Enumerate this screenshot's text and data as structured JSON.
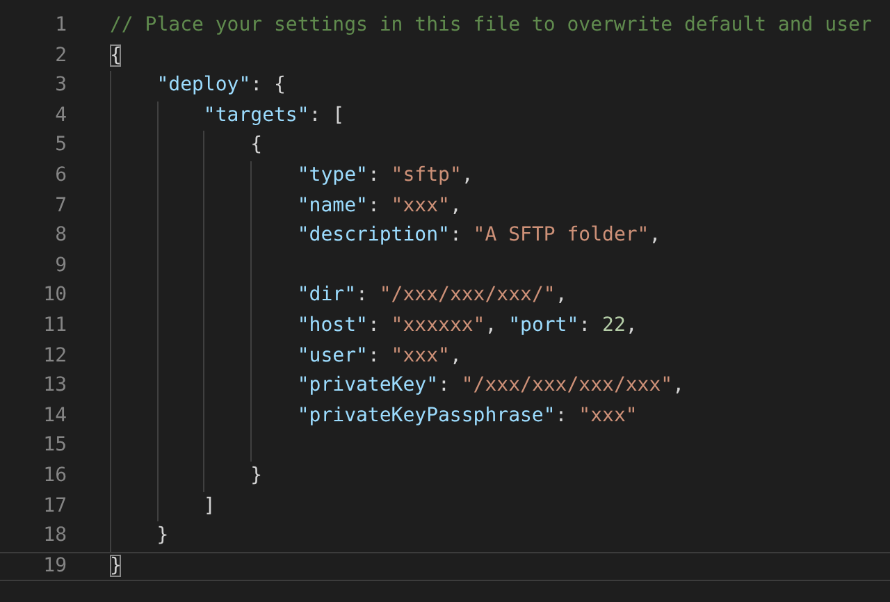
{
  "editor": {
    "lines": [
      {
        "number": "1",
        "current": false,
        "tokens": [
          {
            "kind": "comment",
            "text": "// Place your settings in this file to overwrite default and user"
          }
        ]
      },
      {
        "number": "2",
        "current": false,
        "tokens": [
          {
            "kind": "punct",
            "text": "{",
            "matched": true
          }
        ]
      },
      {
        "number": "3",
        "current": false,
        "tokens": [
          {
            "kind": "key",
            "text": "    \"deploy\""
          },
          {
            "kind": "punct",
            "text": ": {"
          }
        ]
      },
      {
        "number": "4",
        "current": false,
        "tokens": [
          {
            "kind": "key",
            "text": "        \"targets\""
          },
          {
            "kind": "punct",
            "text": ": ["
          }
        ]
      },
      {
        "number": "5",
        "current": false,
        "tokens": [
          {
            "kind": "punct",
            "text": "            {"
          }
        ]
      },
      {
        "number": "6",
        "current": false,
        "tokens": [
          {
            "kind": "key",
            "text": "                \"type\""
          },
          {
            "kind": "punct",
            "text": ": "
          },
          {
            "kind": "string",
            "text": "\"sftp\""
          },
          {
            "kind": "punct",
            "text": ","
          }
        ]
      },
      {
        "number": "7",
        "current": false,
        "tokens": [
          {
            "kind": "key",
            "text": "                \"name\""
          },
          {
            "kind": "punct",
            "text": ": "
          },
          {
            "kind": "string",
            "text": "\"xxx\""
          },
          {
            "kind": "punct",
            "text": ","
          }
        ]
      },
      {
        "number": "8",
        "current": false,
        "tokens": [
          {
            "kind": "key",
            "text": "                \"description\""
          },
          {
            "kind": "punct",
            "text": ": "
          },
          {
            "kind": "string",
            "text": "\"A SFTP folder\""
          },
          {
            "kind": "punct",
            "text": ","
          }
        ]
      },
      {
        "number": "9",
        "current": false
      },
      {
        "number": "10",
        "current": false,
        "tokens": [
          {
            "kind": "key",
            "text": "                \"dir\""
          },
          {
            "kind": "punct",
            "text": ": "
          },
          {
            "kind": "string",
            "text": "\"/xxx/xxx/xxx/\""
          },
          {
            "kind": "punct",
            "text": ","
          }
        ]
      },
      {
        "number": "11",
        "current": false,
        "tokens": [
          {
            "kind": "key",
            "text": "                \"host\""
          },
          {
            "kind": "punct",
            "text": ": "
          },
          {
            "kind": "string",
            "text": "\"xxxxxx\""
          },
          {
            "kind": "punct",
            "text": ", "
          },
          {
            "kind": "key",
            "text": "\"port\""
          },
          {
            "kind": "punct",
            "text": ": "
          },
          {
            "kind": "number",
            "text": "22"
          },
          {
            "kind": "punct",
            "text": ","
          }
        ]
      },
      {
        "number": "12",
        "current": false,
        "tokens": [
          {
            "kind": "key",
            "text": "                \"user\""
          },
          {
            "kind": "punct",
            "text": ": "
          },
          {
            "kind": "string",
            "text": "\"xxx\""
          },
          {
            "kind": "punct",
            "text": ","
          }
        ]
      },
      {
        "number": "13",
        "current": false,
        "tokens": [
          {
            "kind": "key",
            "text": "                \"privateKey\""
          },
          {
            "kind": "punct",
            "text": ": "
          },
          {
            "kind": "string",
            "text": "\"/xxx/xxx/xxx/xxx\""
          },
          {
            "kind": "punct",
            "text": ","
          }
        ]
      },
      {
        "number": "14",
        "current": false,
        "tokens": [
          {
            "kind": "key",
            "text": "                \"privateKeyPassphrase\""
          },
          {
            "kind": "punct",
            "text": ": "
          },
          {
            "kind": "string",
            "text": "\"xxx\""
          }
        ]
      },
      {
        "number": "15",
        "current": false
      },
      {
        "number": "16",
        "current": false,
        "tokens": [
          {
            "kind": "punct",
            "text": "            }"
          }
        ]
      },
      {
        "number": "17",
        "current": false,
        "tokens": [
          {
            "kind": "punct",
            "text": "        ]"
          }
        ]
      },
      {
        "number": "18",
        "current": false,
        "tokens": [
          {
            "kind": "punct",
            "text": "    }"
          }
        ]
      },
      {
        "number": "19",
        "current": true,
        "tokens": [
          {
            "kind": "punct",
            "text": "}",
            "matched": true
          }
        ]
      }
    ]
  }
}
